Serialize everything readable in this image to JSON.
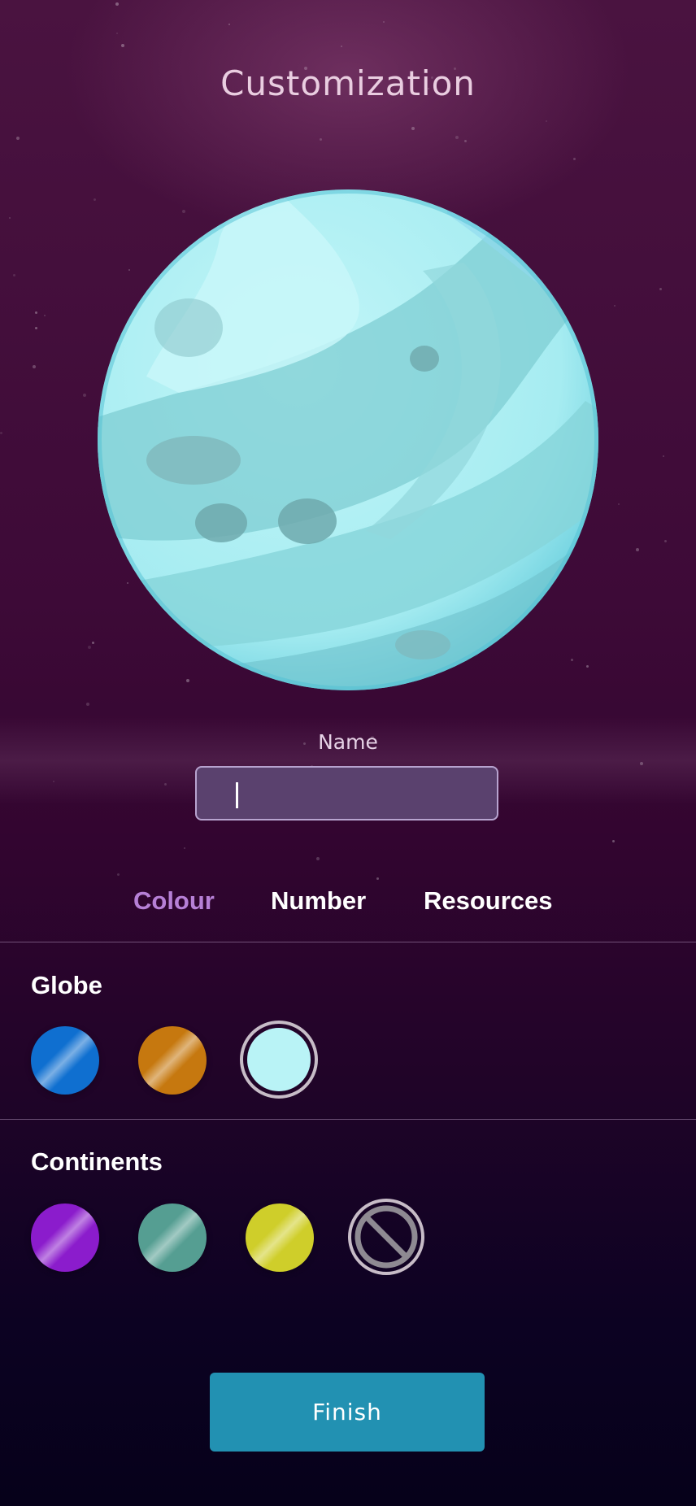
{
  "screen": {
    "title": "Customization"
  },
  "name_field": {
    "label": "Name",
    "value": "",
    "placeholder": ""
  },
  "tabs": [
    {
      "label": "Colour",
      "active": true
    },
    {
      "label": "Number",
      "active": false
    },
    {
      "label": "Resources",
      "active": false
    }
  ],
  "globe": {
    "heading": "Globe",
    "swatches": [
      {
        "color": "#0f6fd0",
        "selected": false
      },
      {
        "color": "#c6780f",
        "selected": false
      },
      {
        "color": "#b9f3f6",
        "selected": true
      }
    ]
  },
  "continents": {
    "heading": "Continents",
    "swatches": [
      {
        "color": "#8b1ccc",
        "selected": false
      },
      {
        "color": "#559e92",
        "selected": false
      },
      {
        "color": "#cfce2a",
        "selected": false
      },
      {
        "color": "none",
        "icon": "no-symbol-icon",
        "selected": false
      }
    ]
  },
  "finish_button": {
    "label": "Finish"
  },
  "colors": {
    "accent_tab": "#b680d6",
    "finish_bg": "#2291b2",
    "planet_base": "#b9f3f6"
  }
}
